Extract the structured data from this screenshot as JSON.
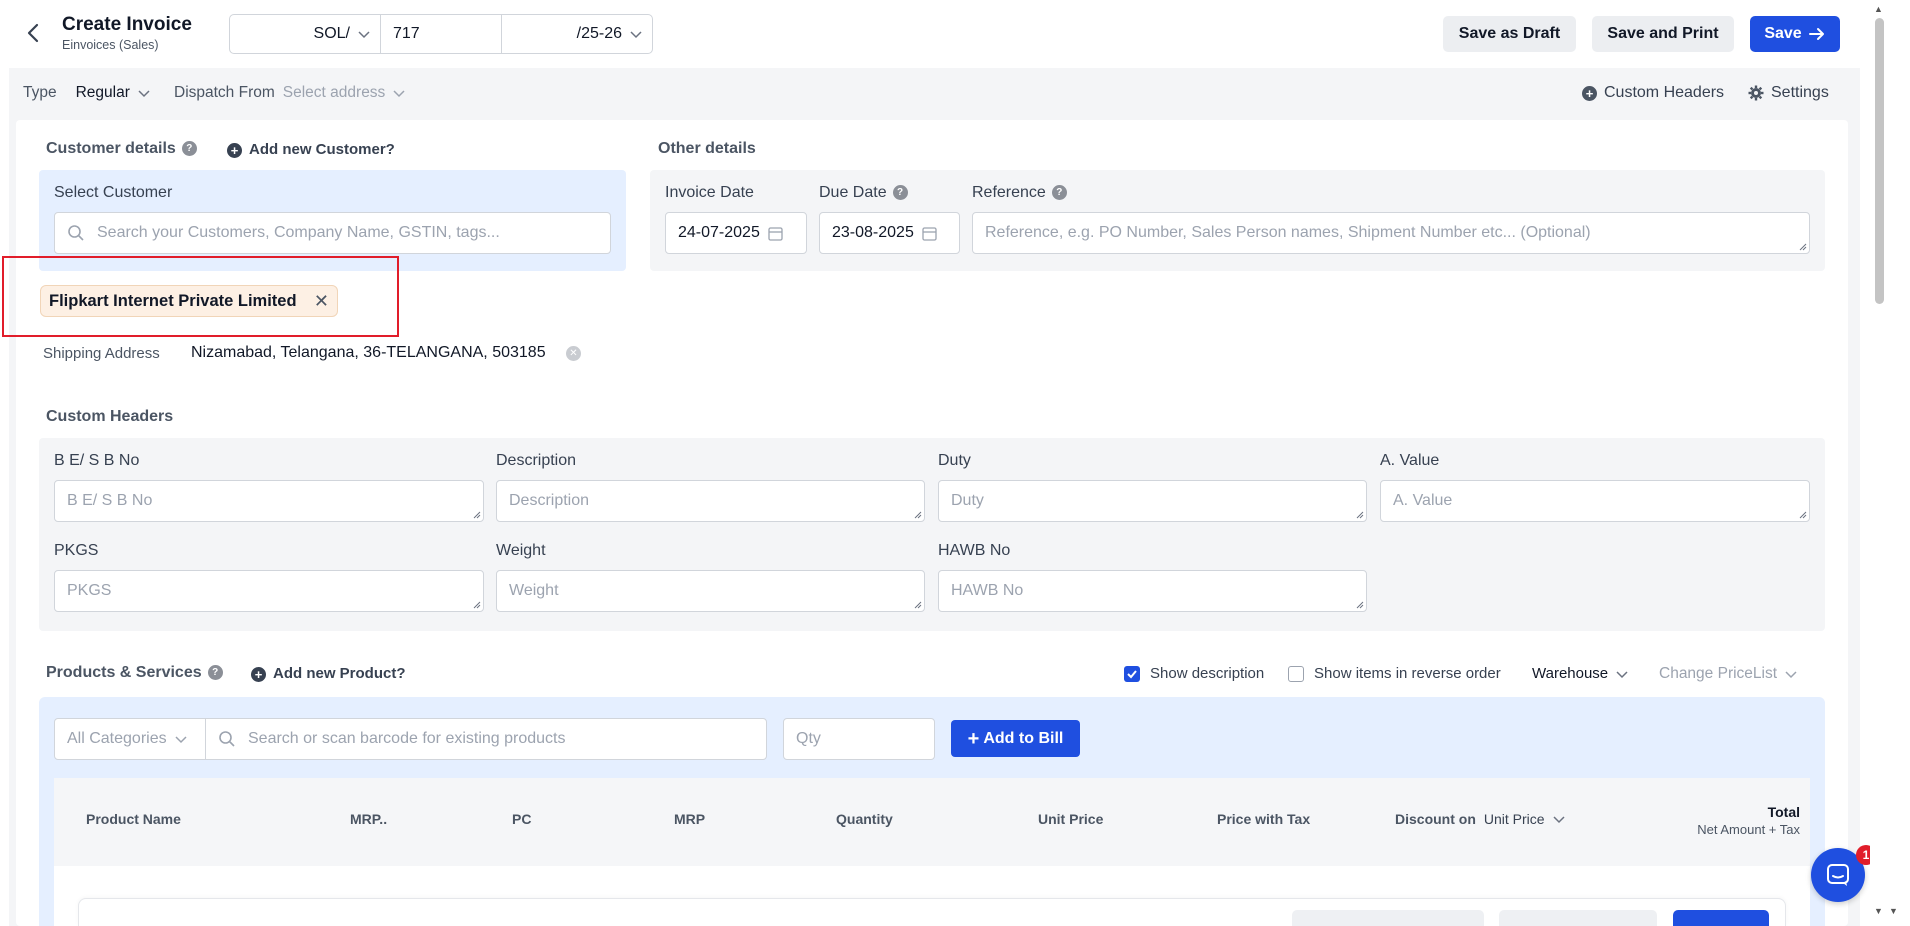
{
  "header": {
    "title": "Create Invoice",
    "subtitle": "Einvoices (Sales)",
    "series_prefix": "SOL/",
    "series_number": "717",
    "series_suffix": "/25-26",
    "draft_label": "Save as Draft",
    "print_label": "Save and Print",
    "save_label": "Save"
  },
  "meta": {
    "type_label": "Type",
    "type_value": "Regular",
    "dispatch_label": "Dispatch From",
    "dispatch_placeholder": "Select address",
    "custom_headers_label": "Custom Headers",
    "settings_label": "Settings"
  },
  "customer": {
    "section_label": "Customer details",
    "add_label": "Add new Customer?",
    "select_label": "Select Customer",
    "search_placeholder": "Search your Customers, Company Name, GSTIN, tags...",
    "selected_name": "Flipkart Internet Private Limited",
    "shipping_label": "Shipping Address",
    "shipping_value": "Nizamabad, Telangana, 36-TELANGANA, 503185"
  },
  "other": {
    "section_label": "Other details",
    "invoice_date_label": "Invoice Date",
    "invoice_date": "24-07-2025",
    "due_date_label": "Due Date",
    "due_date": "23-08-2025",
    "reference_label": "Reference",
    "reference_placeholder": "Reference, e.g. PO Number, Sales Person names, Shipment Number etc... (Optional)"
  },
  "custom_headers": {
    "section_label": "Custom Headers",
    "fields": [
      {
        "label": "B E/ S B No",
        "placeholder": "B E/ S B No"
      },
      {
        "label": "Description",
        "placeholder": "Description"
      },
      {
        "label": "Duty",
        "placeholder": "Duty"
      },
      {
        "label": "A. Value",
        "placeholder": "A. Value"
      },
      {
        "label": "PKGS",
        "placeholder": "PKGS"
      },
      {
        "label": "Weight",
        "placeholder": "Weight"
      },
      {
        "label": "HAWB No",
        "placeholder": "HAWB No"
      }
    ]
  },
  "products": {
    "section_label": "Products & Services",
    "add_label": "Add new Product?",
    "show_description_label": "Show description",
    "show_description_checked": true,
    "reverse_order_label": "Show items in reverse order",
    "reverse_order_checked": false,
    "warehouse_label": "Warehouse",
    "pricelist_label": "Change PriceList",
    "category_placeholder": "All Categories",
    "search_placeholder": "Search or scan barcode for existing products",
    "qty_placeholder": "Qty",
    "add_to_bill_label": "Add to Bill",
    "columns": [
      "Product Name",
      "MRP..",
      "PC",
      "MRP",
      "Quantity",
      "Unit Price",
      "Price with Tax"
    ],
    "discount_label": "Discount on",
    "discount_value": "Unit Price",
    "total_label": "Total",
    "total_sub_label": "Net Amount + Tax"
  },
  "chat": {
    "badge": "1"
  },
  "colors": {
    "primary": "#1f4fe0",
    "highlight": "#e11d2a",
    "chip_bg": "#fdf0e4",
    "panel_blue": "#e5efff"
  }
}
